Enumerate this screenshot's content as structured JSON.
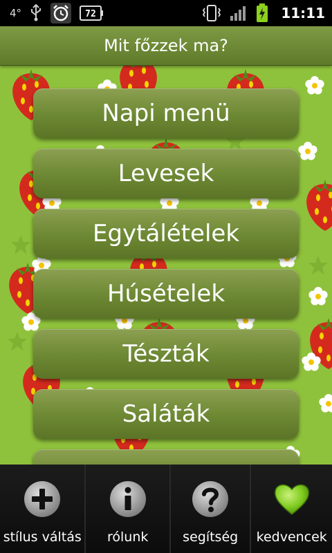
{
  "status_bar": {
    "temperature": "4°",
    "battery_level": "72",
    "time": "11:11",
    "icons": [
      "usb-icon",
      "alarm-clock-icon",
      "battery-notification-icon",
      "vibrate-icon",
      "signal-icon",
      "battery-charging-icon"
    ]
  },
  "app": {
    "title": "Mit főzzek ma?"
  },
  "menu": {
    "items": [
      {
        "label": "Napi menü"
      },
      {
        "label": "Levesek"
      },
      {
        "label": "Egytálételek"
      },
      {
        "label": "Húsételek"
      },
      {
        "label": "Tészták"
      },
      {
        "label": "Saláták"
      }
    ]
  },
  "tabs": [
    {
      "label": "stílus váltás",
      "icon": "plus-icon"
    },
    {
      "label": "rólunk",
      "icon": "info-icon"
    },
    {
      "label": "segítség",
      "icon": "help-icon"
    },
    {
      "label": "kedvencek",
      "icon": "heart-icon"
    }
  ],
  "colors": {
    "background_green": "#8fc23c",
    "button_green": "#6f8a35",
    "strawberry_red": "#d42a1e",
    "heart_green": "#7ecb1e"
  }
}
